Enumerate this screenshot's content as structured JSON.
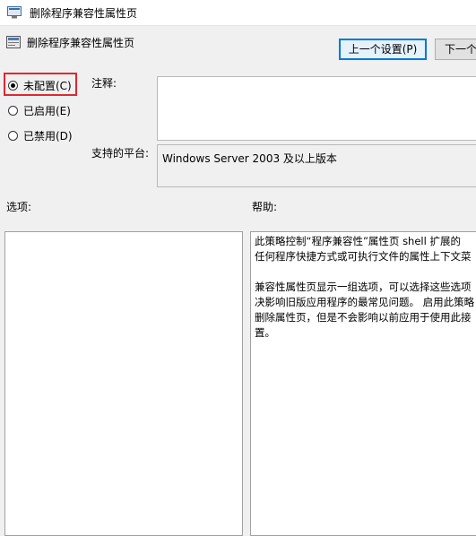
{
  "window": {
    "title": "删除程序兼容性属性页"
  },
  "header": {
    "title": "删除程序兼容性属性页"
  },
  "nav": {
    "prev_label": "上一个设置(P)",
    "next_label": "下一个"
  },
  "state": {
    "options": [
      {
        "label": "未配置(C)",
        "checked": true
      },
      {
        "label": "已启用(E)",
        "checked": false
      },
      {
        "label": "已禁用(D)",
        "checked": false
      }
    ]
  },
  "comment": {
    "label": "注释:"
  },
  "platform": {
    "label": "支持的平台:",
    "value": "Windows Server 2003 及以上版本"
  },
  "options_panel": {
    "label": "选项:"
  },
  "help_panel": {
    "label": "帮助:",
    "paragraphs": [
      [
        "此策略控制“程序兼容性”属性页 shell 扩展的",
        "任何程序快捷方式或可执行文件的属性上下文菜"
      ],
      [
        "兼容性属性页显示一组选项，可以选择这些选项",
        "决影响旧版应用程序的最常见问题。 启用此策略",
        "删除属性页，但是不会影响以前应用于使用此接",
        "置。"
      ]
    ]
  },
  "colors": {
    "highlight": "#e0282e",
    "focus": "#0078d7"
  }
}
